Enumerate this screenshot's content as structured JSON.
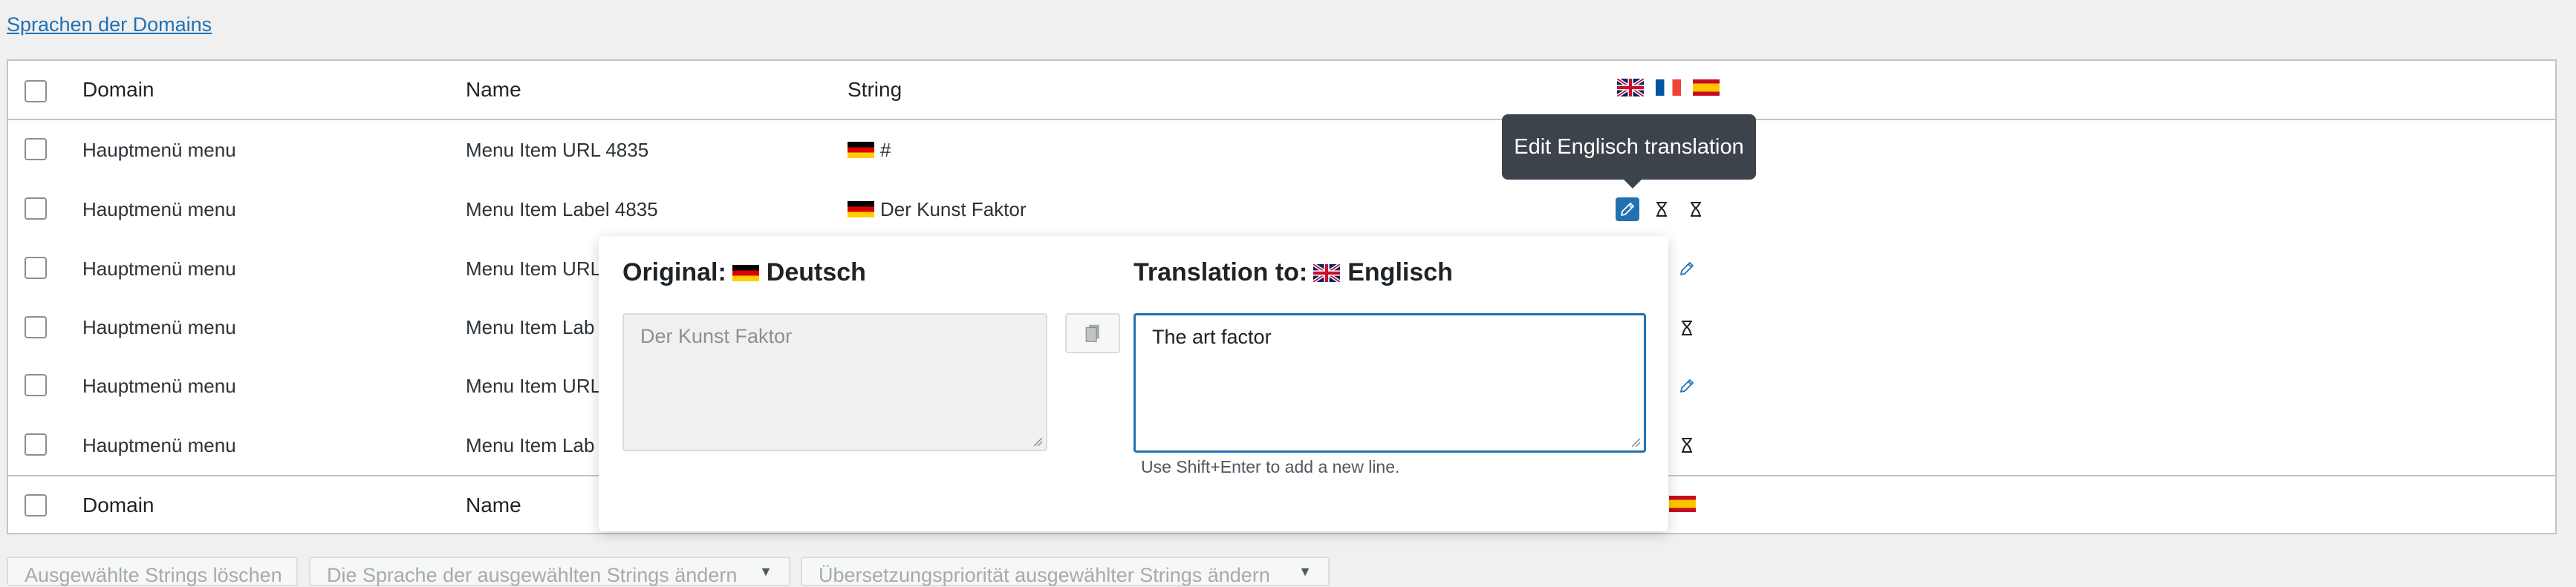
{
  "top_link": "Sprachen der Domains",
  "columns": {
    "domain": "Domain",
    "name": "Name",
    "string": "String"
  },
  "rows": [
    {
      "domain": "Hauptmenü menu",
      "name": "Menu Item URL 4835",
      "string": "#"
    },
    {
      "domain": "Hauptmenü menu",
      "name": "Menu Item Label 4835",
      "string": "Der Kunst Faktor"
    },
    {
      "domain": "Hauptmenü menu",
      "name": "Menu Item URL"
    },
    {
      "domain": "Hauptmenü menu",
      "name": "Menu Item Lab"
    },
    {
      "domain": "Hauptmenü menu",
      "name": "Menu Item URL"
    },
    {
      "domain": "Hauptmenü menu",
      "name": "Menu Item Lab"
    }
  ],
  "tooltip": "Edit Englisch translation",
  "popup": {
    "original_label": "Original:",
    "original_lang": "Deutsch",
    "original_text": "Der Kunst Faktor",
    "translation_label": "Translation to:",
    "translation_lang": "Englisch",
    "translation_text": "The art factor",
    "hint": "Use Shift+Enter to add a new line."
  },
  "bottom_buttons": [
    "Ausgewählte Strings löschen",
    "Die Sprache der ausgewählten Strings ändern",
    "Übersetzungspriorität ausgewählter Strings ändern"
  ],
  "colors": {
    "accent": "#2271b1",
    "tooltip_bg": "#3c434a"
  },
  "icons": [
    "gb-flag-icon",
    "fr-flag-icon",
    "es-flag-icon",
    "pencil-icon",
    "hourglass-icon",
    "copy-icon"
  ]
}
